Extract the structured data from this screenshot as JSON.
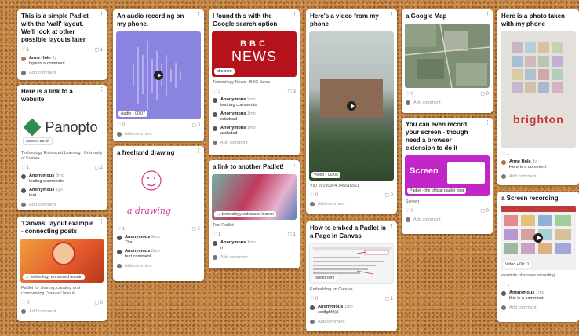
{
  "card1": {
    "title": "This is a simple Padlet with the 'wall' layout. We'll look at other possible layouts later.",
    "likes": "1",
    "comments": "1",
    "comment": {
      "author": "Anne Hole",
      "ago": "3y",
      "text": "type in a comment"
    },
    "add": "Add comment"
  },
  "card2": {
    "title": "Here is a link to a website",
    "logo": "Panopto",
    "domain": "sussex.ac.uk",
    "desc": "Technology Enhanced Learning | University of Sussex",
    "likes": "1",
    "comments": "2",
    "comments_list": [
      {
        "author": "Anonymous",
        "ago": "8mo",
        "text": "testing comments"
      },
      {
        "author": "Anonymous",
        "ago": "1yo",
        "text": "test"
      }
    ],
    "add": "Add comment"
  },
  "card3": {
    "title": "'Canvas' layout example - connecting posts",
    "pill": "technology enhanced learnin",
    "desc": "Padlet for sharing, curating and commenting ('canvas' layout)",
    "likes": "0",
    "comments": "0",
    "add": "Add comment"
  },
  "card4": {
    "title": "An audio recording on my phone.",
    "pill": "Audio • 00:07",
    "likes": "0",
    "comments": "0",
    "add": "Add comment"
  },
  "card5": {
    "title": "a freehand drawing",
    "drawing_text": "a drawing",
    "likes": "1",
    "comments": "2",
    "comments_list": [
      {
        "author": "Anonymous",
        "ago": "9mo",
        "text": "The"
      },
      {
        "author": "Anonymous",
        "ago": "8mo",
        "text": "test comment"
      }
    ],
    "add": "Add comment"
  },
  "card6": {
    "title": "I found this with the Google search option",
    "logo_top": "BBC",
    "logo_bottom": "NEWS",
    "pill": "bbc.com",
    "desc": "Technology News - BBC News",
    "likes": "3",
    "comments": "3",
    "comments_list": [
      {
        "author": "Anonymous",
        "ago": "2mo",
        "text": "test arg comments"
      },
      {
        "author": "Anonymous",
        "ago": "1mo",
        "text": "sdadsad"
      },
      {
        "author": "Anonymous",
        "ago": "1mo",
        "text": "asdadad"
      }
    ],
    "add": "Add comment"
  },
  "card7": {
    "title": "a link to another Padlet!",
    "pill": "technology enhanced learnin",
    "desc": "Test Padlet",
    "likes": "1",
    "comments": "1",
    "comment": {
      "author": "Anonymous",
      "ago": "1mo",
      "text": "n"
    },
    "add": "Add comment"
  },
  "card8": {
    "title": "Here's a video from my phone",
    "pill": "Video • 00:05",
    "desc": "VID 20190304 145516521",
    "likes": "0",
    "comments": "0",
    "add": "Add comment"
  },
  "card9": {
    "title": "How to embed a Padlet in a Page in Canvas",
    "pill": "padlet.com",
    "desc": "Embedding on Canvas",
    "likes": "0",
    "comments": "1",
    "comment": {
      "author": "Anonymous",
      "ago": "1mo",
      "text": "sodfghhl(/)"
    },
    "add": "Add comment"
  },
  "card10": {
    "title": "a Google Map",
    "likes": "0",
    "comments": "0",
    "add": "Add comment"
  },
  "card11": {
    "title": "You can even record your screen - though need a browser extension to do it",
    "screen_label": "Screen",
    "pill": "Padlet - the official padlet blog",
    "desc": "Screen",
    "likes": "0",
    "comments": "0",
    "add": "Add comment"
  },
  "card12": {
    "title": "Here is a photo taken with my phone",
    "poster_text": "brighton",
    "likes": "1",
    "comment": {
      "author": "Anne Hole",
      "ago": "3y",
      "text": "Here is a comment"
    },
    "add": "Add comment"
  },
  "card13": {
    "title": "a Screen recording",
    "pill": "Video • 00:11",
    "desc": "example of screen recording",
    "likes": "1",
    "comment": {
      "author": "Anonymous",
      "ago": "1mo",
      "text": "this is a comment"
    },
    "add": "Add comment"
  },
  "icons": {
    "heart": "heart-icon",
    "comment": "comment-bubble-icon",
    "more": "kebab-menu-icon"
  }
}
